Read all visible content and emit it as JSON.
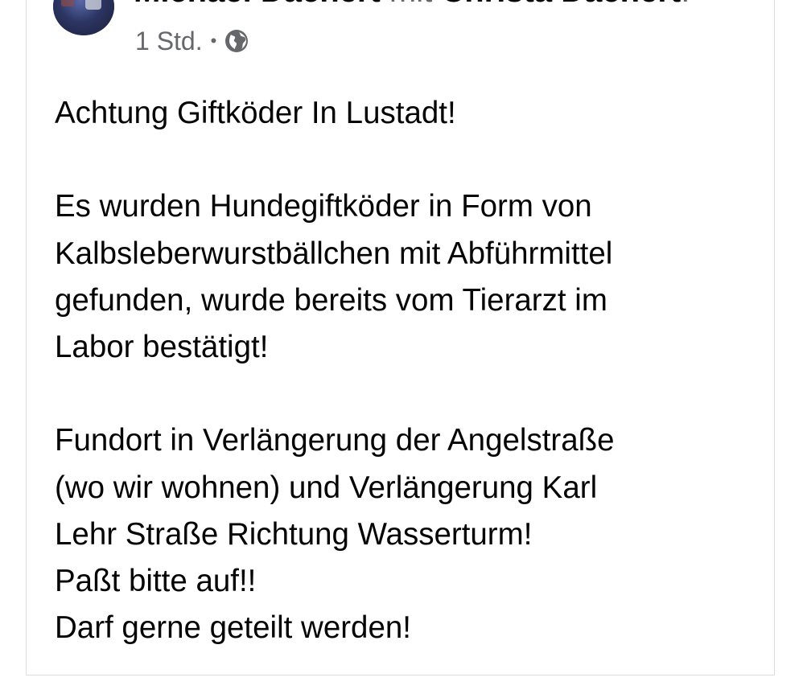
{
  "post": {
    "author": "Michael Dachert",
    "with_word": "mit",
    "tagged": "Christa Dachert",
    "trailing": ".",
    "time": "1 Std.",
    "separator": "•",
    "audience_icon": "globe-icon",
    "paragraphs": [
      [
        "Achtung Giftköder In Lustadt!"
      ],
      [
        "Es wurden Hundegiftköder in Form von",
        "Kalbsleberwurstbällchen mit Abführmittel",
        "gefunden, wurde bereits vom Tierarzt im",
        "Labor bestätigt!"
      ],
      [
        "Fundort in Verlängerung der Angelstraße",
        "(wo wir wohnen) und Verlängerung Karl",
        "Lehr Straße Richtung Wasserturm!",
        "Paßt bitte auf!!",
        "Darf gerne geteilt werden!"
      ]
    ]
  },
  "colors": {
    "text": "#050505",
    "secondary_text": "#65676b",
    "border": "#dadde1",
    "background": "#ffffff"
  }
}
